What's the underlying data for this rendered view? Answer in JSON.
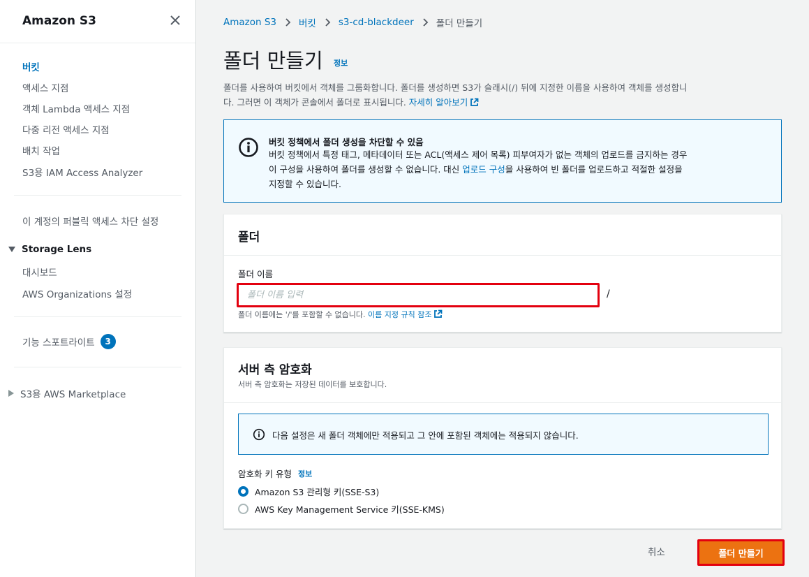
{
  "sidebar": {
    "title": "Amazon S3",
    "items": [
      {
        "label": "버킷"
      },
      {
        "label": "액세스 지점"
      },
      {
        "label": "객체 Lambda 액세스 지점"
      },
      {
        "label": "다중 리전 액세스 지점"
      },
      {
        "label": "배치 작업"
      },
      {
        "label": "S3용 IAM Access Analyzer"
      }
    ],
    "public_access": "이 계정의 퍼블릭 액세스 차단 설정",
    "storage_lens": {
      "label": "Storage Lens",
      "items": [
        {
          "label": "대시보드"
        },
        {
          "label": "AWS Organizations 설정"
        }
      ]
    },
    "feature_spotlight": {
      "label": "기능 스포트라이트",
      "badge": "3"
    },
    "marketplace": "S3용 AWS Marketplace"
  },
  "breadcrumb": [
    "Amazon S3",
    "버킷",
    "s3-cd-blackdeer",
    "폴더 만들기"
  ],
  "page": {
    "title": "폴더 만들기",
    "info": "정보",
    "description_line1": "폴더를 사용하여 버킷에서 객체를 그룹화합니다. 폴더를 생성하면 S3가 슬래시(/) 뒤에 지정한 이름을 사용하여 객체를 생성합니",
    "description_line2": "다. 그러면 이 객체가 콘솔에서 폴더로 표시됩니다.",
    "learn_more": "자세히 알아보기"
  },
  "alert": {
    "title": "버킷 정책에서 폴더 생성을 차단할 수 있음",
    "line1": "버킷 정책에서 특정 태그, 메타데이터 또는 ACL(액세스 제어 목록) 피부여자가 없는 객체의 업로드를 금지하는 경우",
    "line2_pre": "이 구성을 사용하여 폴더를 생성할 수 없습니다. 대신 ",
    "line2_link": "업로드 구성",
    "line2_post": "을 사용하여 빈 폴더를 업로드하고 적절한 설정을",
    "line3": "지정할 수 있습니다."
  },
  "folder_panel": {
    "title": "폴더",
    "field_label": "폴더 이름",
    "placeholder": "폴더 이름 입력",
    "value": "",
    "suffix": "/",
    "hint_pre": "폴더 이름에는 '/'를 포함할 수 없습니다. ",
    "hint_link": "이름 지정 규칙 참조"
  },
  "encryption_panel": {
    "title": "서버 측 암호화",
    "subtitle": "서버 측 암호화는 저장된 데이터를 보호합니다.",
    "info_text": "다음 설정은 새 폴더 객체에만 적용되고 그 안에 포함된 객체에는 적용되지 않습니다.",
    "key_type_label": "암호화 키 유형",
    "key_type_info": "정보",
    "options": [
      {
        "label": "Amazon S3 관리형 키(SSE-S3)",
        "selected": true
      },
      {
        "label": "AWS Key Management Service 키(SSE-KMS)",
        "selected": false
      }
    ]
  },
  "actions": {
    "cancel": "취소",
    "create": "폴더 만들기"
  },
  "colors": {
    "link": "#0073bb",
    "primary_button": "#ec7211",
    "highlight": "#e3000f"
  }
}
